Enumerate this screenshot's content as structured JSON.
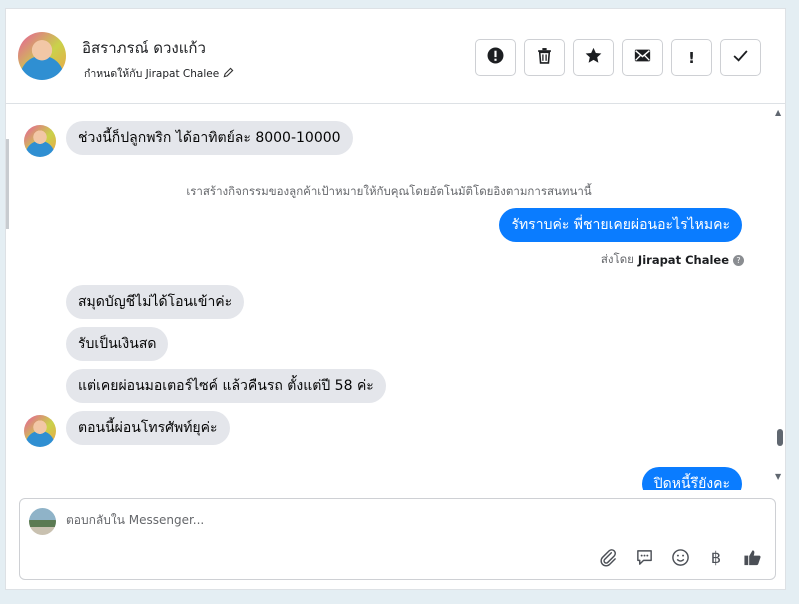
{
  "header": {
    "contact_name": "อิสราภรณ์ ดวงแก้ว",
    "assigned_label": "กำหนดให้กับ Jirapat Chalee",
    "actions": [
      {
        "name": "spam-button",
        "icon": "alert-circle-icon"
      },
      {
        "name": "delete-button",
        "icon": "trash-icon"
      },
      {
        "name": "star-button",
        "icon": "star-icon"
      },
      {
        "name": "mark-unread-button",
        "icon": "envelope-icon"
      },
      {
        "name": "flag-button",
        "icon": "exclamation-icon",
        "label": "!"
      },
      {
        "name": "mark-done-button",
        "icon": "check-icon"
      }
    ]
  },
  "messages": {
    "m1": "ช่วงนี้ก็ปลูกพริก ได้อาทิตย์ละ 8000-10000",
    "system_note": "เราสร้างกิจกรรมของลูกค้าเป้าหมายให้กับคุณโดยอัตโนมัติโดยอิงตามการสนทนานี้",
    "m2_out": "รัทราบค่ะ พี่ชายเคยผ่อนอะไรไหมคะ",
    "sent_by_prefix": "ส่งโดย",
    "sent_by_name": "Jirapat Chalee",
    "m3": "สมุดบัญชีไม่ได้โอนเข้าค่ะ",
    "m4": "รับเป็นเงินสด",
    "m5": "แต่เคยผ่อนมอเตอร์ไซค์ แล้วคืนรถ ตั้งแต่ปี 58 ค่ะ",
    "m6": "ตอนนี้ผ่อนโทรศัพท์ยุค่ะ",
    "m7_out": "ปิดหนี้รึยังคะ"
  },
  "composer": {
    "placeholder": "ตอบกลับใน Messenger...",
    "tools": [
      "paperclip-icon",
      "speech-bubble-icon",
      "smiley-icon",
      "baht-icon",
      "thumbs-up-icon"
    ],
    "baht_symbol": "฿"
  },
  "colors": {
    "outgoing_bubble": "#0a7cff",
    "incoming_bubble": "#e4e6eb",
    "background": "#e4eef3"
  }
}
